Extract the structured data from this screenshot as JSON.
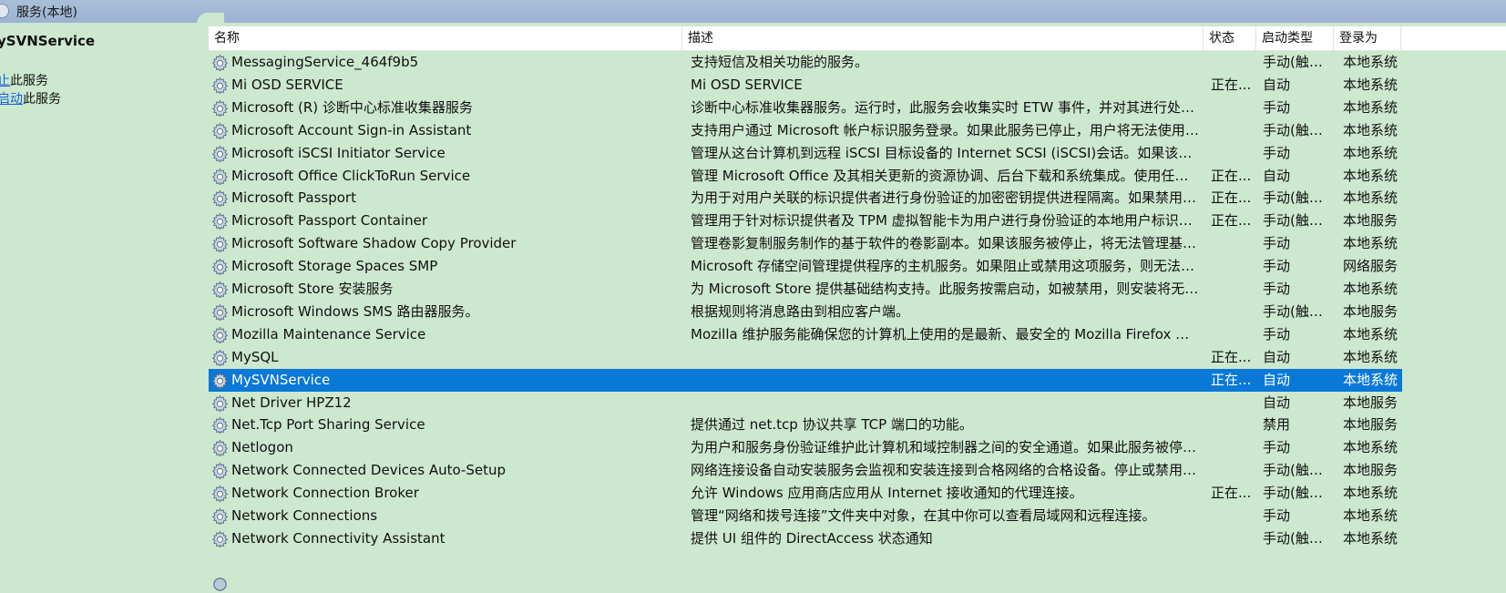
{
  "window": {
    "title": "服务(本地)"
  },
  "left_pane": {
    "service_title": "ySVNService",
    "actions": [
      {
        "link": "止",
        "suffix": "此服务"
      },
      {
        "link": "启动",
        "suffix": "此服务"
      }
    ]
  },
  "table": {
    "columns": [
      "名称",
      "描述",
      "状态",
      "启动类型",
      "登录为"
    ],
    "sort_indicator": "ˆ",
    "selected_index": 14,
    "rows": [
      {
        "name": "MessagingService_464f9b5",
        "desc": "支持短信及相关功能的服务。",
        "status": "",
        "startup": "手动(触发...",
        "logon": "本地系统"
      },
      {
        "name": "Mi OSD SERVICE",
        "desc": "Mi OSD SERVICE",
        "status": "正在...",
        "startup": "自动",
        "logon": "本地系统"
      },
      {
        "name": "Microsoft (R) 诊断中心标准收集器服务",
        "desc": "诊断中心标准收集器服务。运行时，此服务会收集实时 ETW 事件，并对其进行处理。",
        "status": "",
        "startup": "手动",
        "logon": "本地系统"
      },
      {
        "name": "Microsoft Account Sign-in Assistant",
        "desc": "支持用户通过 Microsoft 帐户标识服务登录。如果此服务已停止，用户将无法使用其 Mi...",
        "status": "",
        "startup": "手动(触发...",
        "logon": "本地系统"
      },
      {
        "name": "Microsoft iSCSI Initiator Service",
        "desc": "管理从这台计算机到远程 iSCSI 目标设备的 Internet SCSI (iSCSI)会话。如果该服务已停...",
        "status": "",
        "startup": "手动",
        "logon": "本地系统"
      },
      {
        "name": "Microsoft Office ClickToRun Service",
        "desc": "管理 Microsoft Office 及其相关更新的资源协调、后台下载和系统集成。使用任何 Micr...",
        "status": "正在...",
        "startup": "自动",
        "logon": "本地系统"
      },
      {
        "name": "Microsoft Passport",
        "desc": "为用于对用户关联的标识提供者进行身份验证的加密密钥提供进程隔离。如果禁用了此...",
        "status": "正在...",
        "startup": "手动(触发...",
        "logon": "本地系统"
      },
      {
        "name": "Microsoft Passport Container",
        "desc": "管理用于针对标识提供者及 TPM 虚拟智能卡为用户进行身份验证的本地用户标识密钥...",
        "status": "正在...",
        "startup": "手动(触发...",
        "logon": "本地服务"
      },
      {
        "name": "Microsoft Software Shadow Copy Provider",
        "desc": "管理卷影复制服务制作的基于软件的卷影副本。如果该服务被停止，将无法管理基于软...",
        "status": "",
        "startup": "手动",
        "logon": "本地系统"
      },
      {
        "name": "Microsoft Storage Spaces SMP",
        "desc": "Microsoft 存储空间管理提供程序的主机服务。如果阻止或禁用这项服务，则无法管理...",
        "status": "",
        "startup": "手动",
        "logon": "网络服务"
      },
      {
        "name": "Microsoft Store 安装服务",
        "desc": "为 Microsoft Store 提供基础结构支持。此服务按需启动，如被禁用，则安装将无法正常...",
        "status": "",
        "startup": "手动",
        "logon": "本地系统"
      },
      {
        "name": "Microsoft Windows SMS 路由器服务。",
        "desc": "根据规则将消息路由到相应客户端。",
        "status": "",
        "startup": "手动(触发...",
        "logon": "本地服务"
      },
      {
        "name": "Mozilla Maintenance Service",
        "desc": "Mozilla 维护服务能确保您的计算机上使用的是最新、最安全的 Mozilla Firefox 版本。...",
        "status": "",
        "startup": "手动",
        "logon": "本地系统"
      },
      {
        "name": "MySQL",
        "desc": "",
        "status": "正在...",
        "startup": "自动",
        "logon": "本地系统"
      },
      {
        "name": "MySVNService",
        "desc": "",
        "status": "正在...",
        "startup": "自动",
        "logon": "本地系统"
      },
      {
        "name": "Net Driver HPZ12",
        "desc": "",
        "status": "",
        "startup": "自动",
        "logon": "本地服务"
      },
      {
        "name": "Net.Tcp Port Sharing Service",
        "desc": "提供通过 net.tcp 协议共享 TCP 端口的功能。",
        "status": "",
        "startup": "禁用",
        "logon": "本地服务"
      },
      {
        "name": "Netlogon",
        "desc": "为用户和服务身份验证维护此计算机和域控制器之间的安全通道。如果此服务被停用，...",
        "status": "",
        "startup": "手动",
        "logon": "本地系统"
      },
      {
        "name": "Network Connected Devices Auto-Setup",
        "desc": "网络连接设备自动安装服务会监视和安装连接到合格网络的合格设备。停止或禁用此服...",
        "status": "",
        "startup": "手动(触发...",
        "logon": "本地服务"
      },
      {
        "name": "Network Connection Broker",
        "desc": "允许 Windows 应用商店应用从 Internet 接收通知的代理连接。",
        "status": "正在...",
        "startup": "手动(触发...",
        "logon": "本地系统"
      },
      {
        "name": "Network Connections",
        "desc": "管理“网络和拨号连接”文件夹中对象，在其中你可以查看局域网和远程连接。",
        "status": "",
        "startup": "手动",
        "logon": "本地系统"
      },
      {
        "name": "Network Connectivity Assistant",
        "desc": "提供 UI 组件的 DirectAccess 状态通知",
        "status": "",
        "startup": "手动(触发...",
        "logon": "本地系统"
      }
    ]
  }
}
